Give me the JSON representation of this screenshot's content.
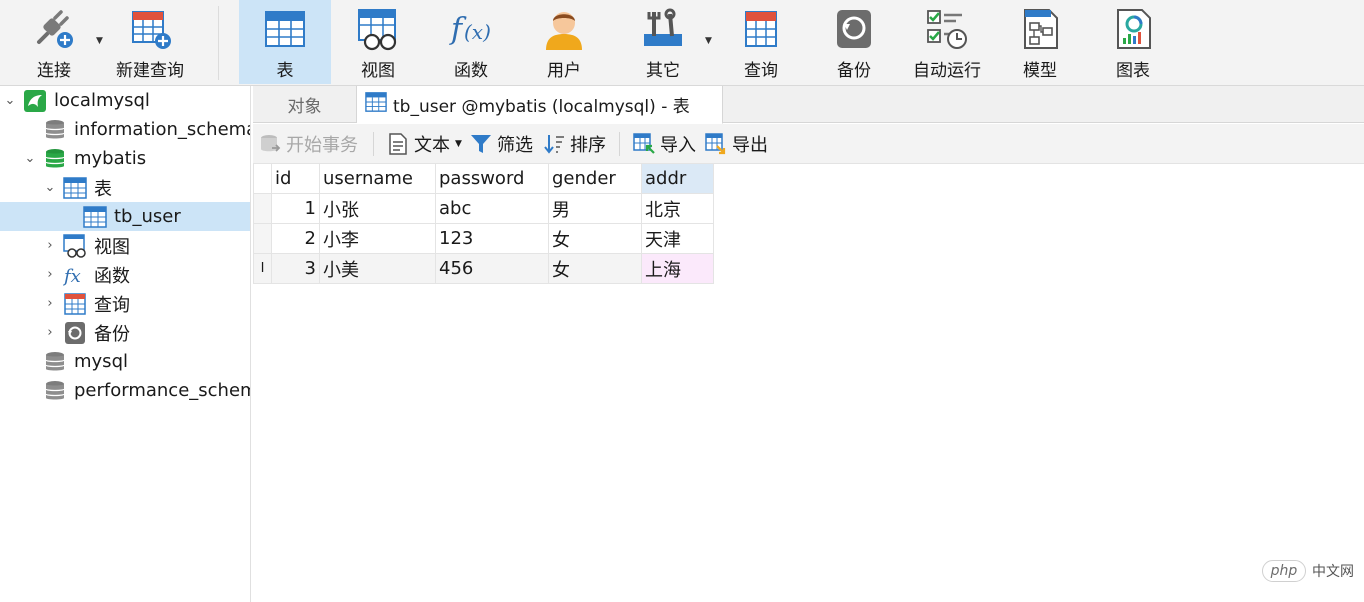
{
  "toolbar": {
    "connect": "连接",
    "new_query": "新建查询",
    "table": "表",
    "view": "视图",
    "function": "函数",
    "user": "用户",
    "other": "其它",
    "query": "查询",
    "backup": "备份",
    "auto_run": "自动运行",
    "model": "模型",
    "chart": "图表"
  },
  "tree": {
    "connection": "localmysql",
    "db_information_schema": "information_schema",
    "db_mybatis": "mybatis",
    "folder_tables": "表",
    "table_tb_user": "tb_user",
    "folder_views": "视图",
    "folder_functions": "函数",
    "folder_queries": "查询",
    "folder_backups": "备份",
    "db_mysql": "mysql",
    "db_performance_schema": "performance_schema"
  },
  "tabs": {
    "objects": "对象",
    "active": "tb_user @mybatis (localmysql) - 表"
  },
  "subtoolbar": {
    "begin_transaction": "开始事务",
    "text": "文本",
    "filter": "筛选",
    "sort": "排序",
    "import": "导入",
    "export": "导出"
  },
  "grid": {
    "columns": [
      "id",
      "username",
      "password",
      "gender",
      "addr"
    ],
    "rows": [
      [
        "1",
        "小张",
        "abc",
        "男",
        "北京"
      ],
      [
        "2",
        "小李",
        "123",
        "女",
        "天津"
      ],
      [
        "3",
        "小美",
        "456",
        "女",
        "上海"
      ]
    ],
    "cursor_marker": "I"
  },
  "watermark": {
    "logo": "php",
    "site": "中文网"
  },
  "colors": {
    "accent_blue": "#2f7bc8",
    "selection": "#cce4f7",
    "mysql_green": "#2aa847"
  },
  "icons": {
    "connect": "plug-icon",
    "new_query": "new-query-icon",
    "table": "table-icon",
    "view": "view-icon",
    "function": "function-icon",
    "user": "user-icon",
    "other": "tools-icon",
    "query": "query-icon",
    "backup": "backup-icon",
    "auto_run": "schedule-icon",
    "model": "model-icon",
    "chart": "chart-icon"
  }
}
